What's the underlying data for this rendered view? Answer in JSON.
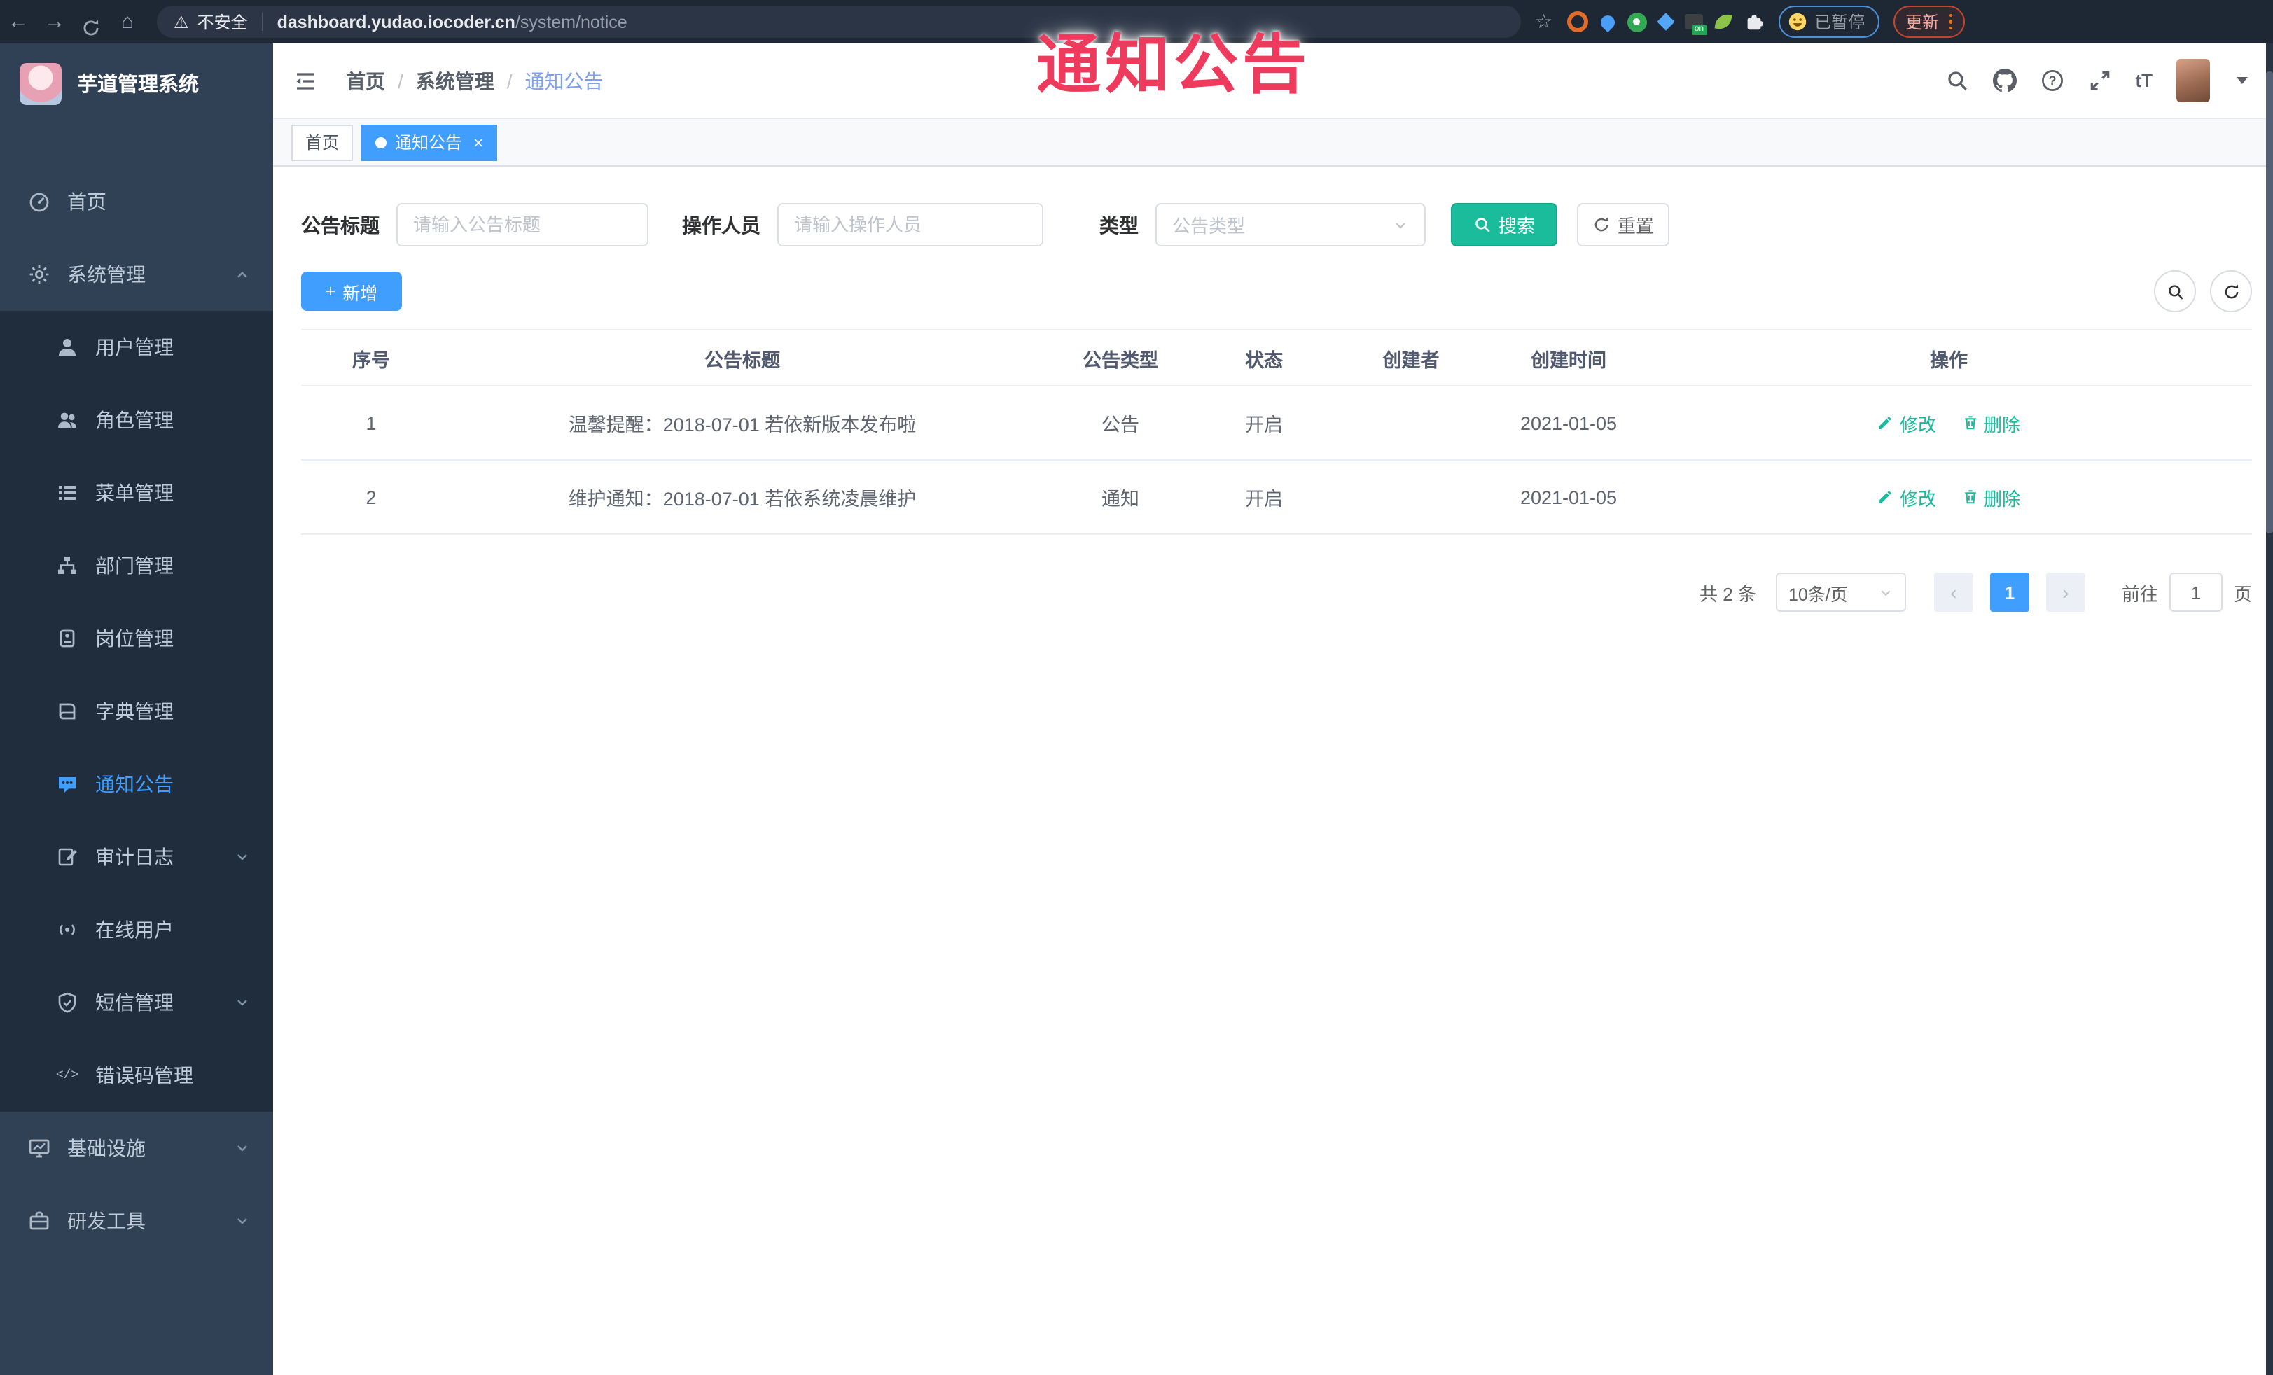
{
  "annotation": {
    "text": "通知公告"
  },
  "browser": {
    "security_label": "不安全",
    "url_host": "dashboard.yudao.iocoder.cn",
    "url_path": "/system/notice",
    "paused_label": "已暂停",
    "update_label": "更新"
  },
  "sidebar": {
    "app_title": "芋道管理系统",
    "items": [
      {
        "label": "首页"
      },
      {
        "label": "系统管理"
      },
      {
        "label": "用户管理"
      },
      {
        "label": "角色管理"
      },
      {
        "label": "菜单管理"
      },
      {
        "label": "部门管理"
      },
      {
        "label": "岗位管理"
      },
      {
        "label": "字典管理"
      },
      {
        "label": "通知公告"
      },
      {
        "label": "审计日志"
      },
      {
        "label": "在线用户"
      },
      {
        "label": "短信管理"
      },
      {
        "label": "错误码管理"
      },
      {
        "label": "基础设施"
      },
      {
        "label": "研发工具"
      }
    ]
  },
  "header": {
    "breadcrumb": [
      "首页",
      "系统管理",
      "通知公告"
    ],
    "separator": "/"
  },
  "tabs": [
    {
      "label": "首页"
    },
    {
      "label": "通知公告",
      "close": "×"
    }
  ],
  "filters": {
    "title_label": "公告标题",
    "title_placeholder": "请输入公告标题",
    "operator_label": "操作人员",
    "operator_placeholder": "请输入操作人员",
    "type_label": "类型",
    "type_placeholder": "公告类型",
    "search_label": "搜索",
    "reset_label": "重置"
  },
  "toolbar": {
    "add_label": "新增"
  },
  "table": {
    "columns": [
      "序号",
      "公告标题",
      "公告类型",
      "状态",
      "创建者",
      "创建时间",
      "操作"
    ],
    "rows": [
      {
        "no": "1",
        "title": "温馨提醒：2018-07-01 若依新版本发布啦",
        "type": "公告",
        "status": "开启",
        "creator": "",
        "created": "2021-01-05"
      },
      {
        "no": "2",
        "title": "维护通知：2018-07-01 若依系统凌晨维护",
        "type": "通知",
        "status": "开启",
        "creator": "",
        "created": "2021-01-05"
      }
    ],
    "edit_label": "修改",
    "delete_label": "删除"
  },
  "pagination": {
    "total_text": "共 2 条",
    "page_size": "10条/页",
    "current_page": "1",
    "goto_label": "前往",
    "goto_value": "1",
    "page_unit": "页"
  },
  "colors": {
    "accent_blue": "#409eff",
    "accent_teal": "#1abc9c",
    "action_green": "#18bc9c",
    "annotation_red": "#ee3b5d",
    "sidebar_bg": "#304156",
    "submenu_bg": "#1f2d3d"
  }
}
